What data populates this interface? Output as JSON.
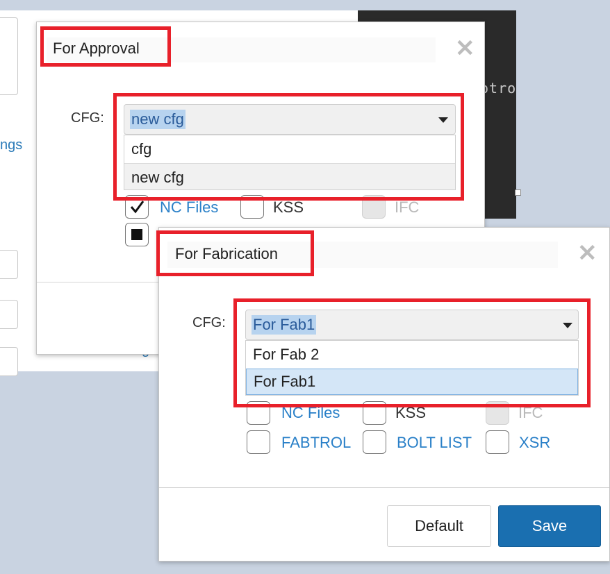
{
  "background": {
    "code_fragment": "otro",
    "link_fragment_1": "ngs",
    "link_fragment_2": "gs"
  },
  "dialog_approval": {
    "title": "For Approval",
    "cfg_label": "CFG:",
    "selected_value": "new cfg",
    "options": [
      "cfg",
      "new cfg"
    ],
    "checkboxes": [
      {
        "label": "NC Files",
        "checked": true,
        "style": "link"
      },
      {
        "label": "KSS",
        "checked": false,
        "style": "plain"
      },
      {
        "label": "IFC",
        "checked": false,
        "style": "disabled"
      }
    ]
  },
  "dialog_fabrication": {
    "title": "For Fabrication",
    "cfg_label": "CFG:",
    "selected_value": "For Fab1",
    "options": [
      "For Fab 2",
      "For Fab1"
    ],
    "checkboxes_row1": [
      {
        "label": "NC Files",
        "style": "link"
      },
      {
        "label": "KSS",
        "style": "plain"
      },
      {
        "label": "IFC",
        "style": "disabled"
      }
    ],
    "checkboxes_row2": [
      {
        "label": "FABTROL",
        "style": "link"
      },
      {
        "label": "BOLT LIST",
        "style": "link"
      },
      {
        "label": "XSR",
        "style": "link"
      }
    ],
    "default_label": "Default",
    "save_label": "Save"
  },
  "colors": {
    "highlight_red": "#e8202a",
    "link_blue": "#2a80c8",
    "save_blue": "#1a6fb0"
  },
  "icons": [
    "close-icon",
    "caret-down-icon",
    "checkmark-icon"
  ]
}
